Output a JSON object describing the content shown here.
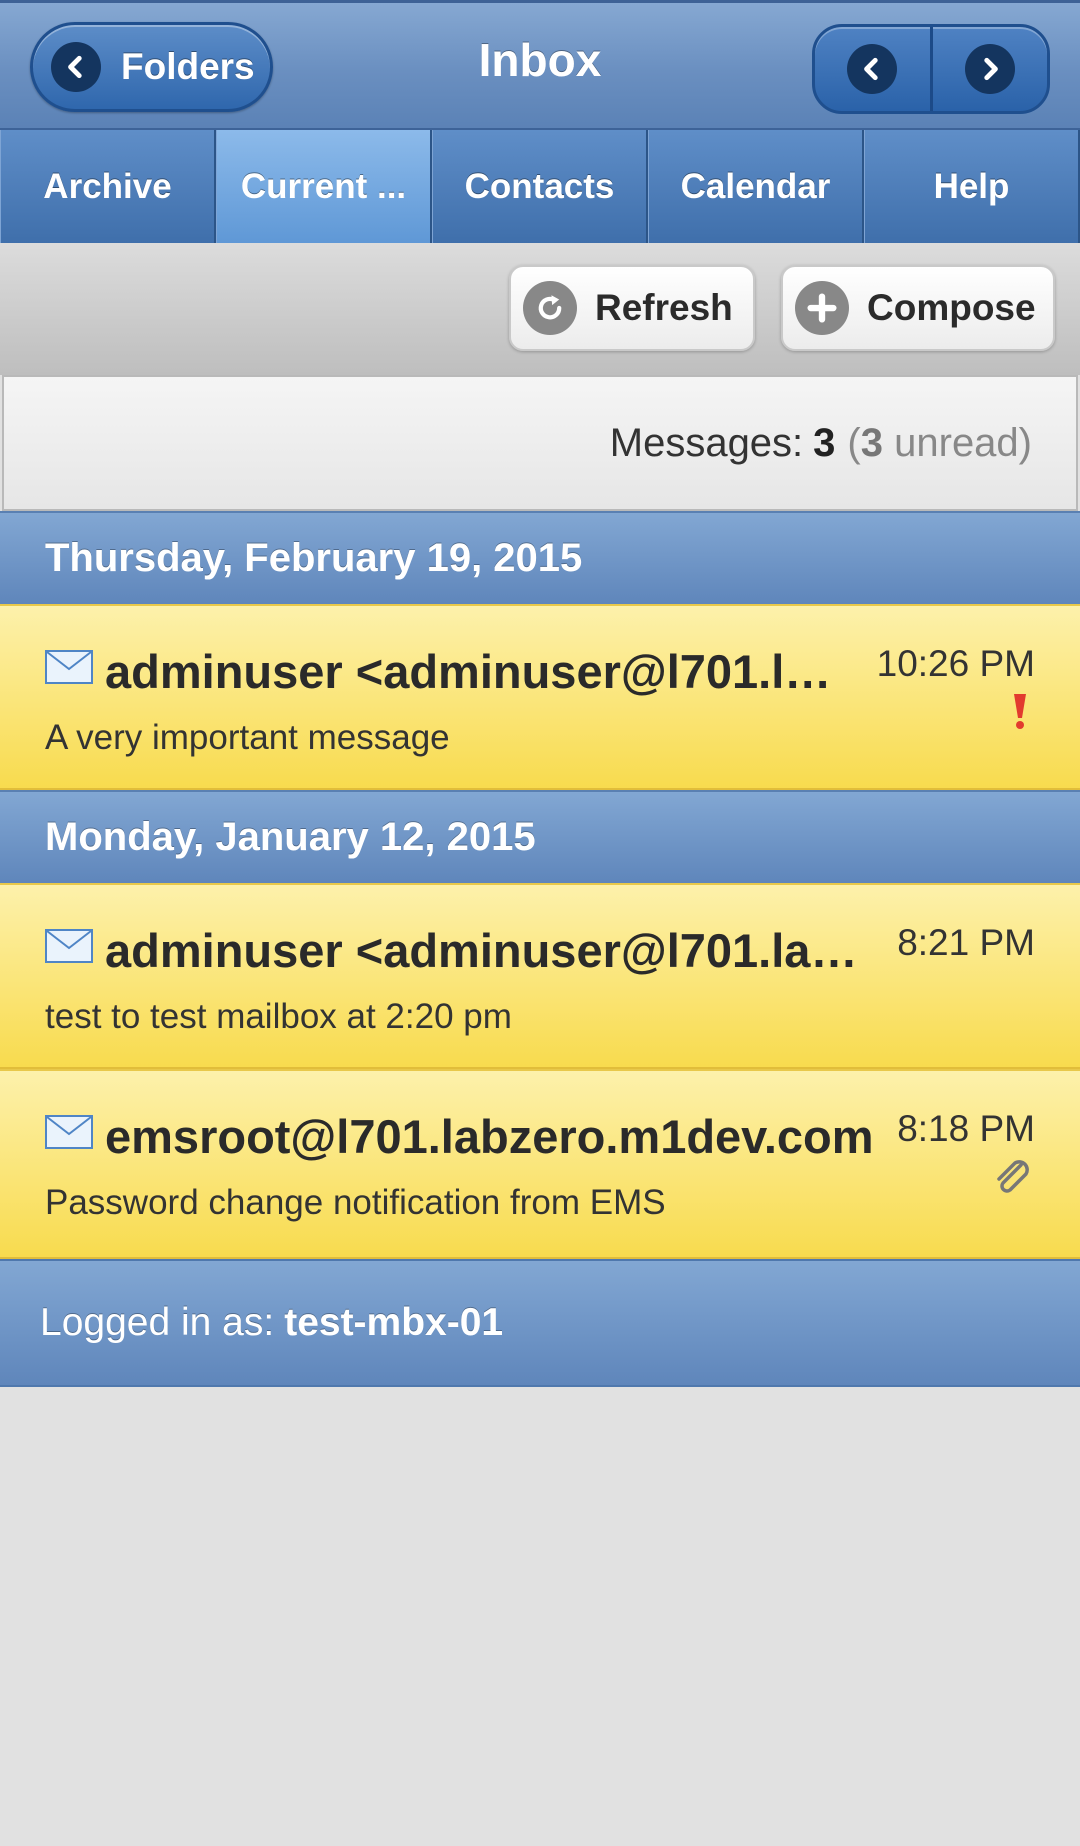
{
  "header": {
    "back_label": "Folders",
    "title": "Inbox",
    "back_icon": "chevron-left-icon",
    "prev_icon": "chevron-left-icon",
    "next_icon": "chevron-right-icon"
  },
  "tabs": [
    {
      "label": "Archive",
      "active": false
    },
    {
      "label": "Current ...",
      "active": true
    },
    {
      "label": "Contacts",
      "active": false
    },
    {
      "label": "Calendar",
      "active": false
    },
    {
      "label": "Help",
      "active": false
    }
  ],
  "toolbar": {
    "refresh_label": "Refresh",
    "refresh_icon": "refresh-icon",
    "compose_label": "Compose",
    "compose_icon": "plus-icon"
  },
  "summary": {
    "label": "Messages:",
    "total": "3",
    "unread_open": "(",
    "unread_count": "3",
    "unread_label": "unread)"
  },
  "groups": [
    {
      "date": "Thursday, February 19, 2015",
      "messages": [
        {
          "from": "adminuser <adminuser@l701.la…",
          "subject": "A very important message",
          "time": "10:26 PM",
          "indicator": "high-priority-icon"
        }
      ]
    },
    {
      "date": "Monday, January 12, 2015",
      "messages": [
        {
          "from": "adminuser <adminuser@l701.lab…",
          "subject": "test to test mailbox at 2:20 pm",
          "time": "8:21 PM",
          "indicator": ""
        },
        {
          "from": "emsroot@l701.labzero.m1dev.com",
          "subject": "Password change notification from EMS",
          "time": "8:18 PM",
          "indicator": "attachment-icon"
        }
      ]
    }
  ],
  "footer": {
    "label": "Logged in as:",
    "user": "test-mbx-01"
  },
  "colors": {
    "header_blue": "#6a8fc0",
    "active_tab": "#7aaee4",
    "message_yellow": "#f8db4e",
    "background": "#e1e1e1"
  }
}
